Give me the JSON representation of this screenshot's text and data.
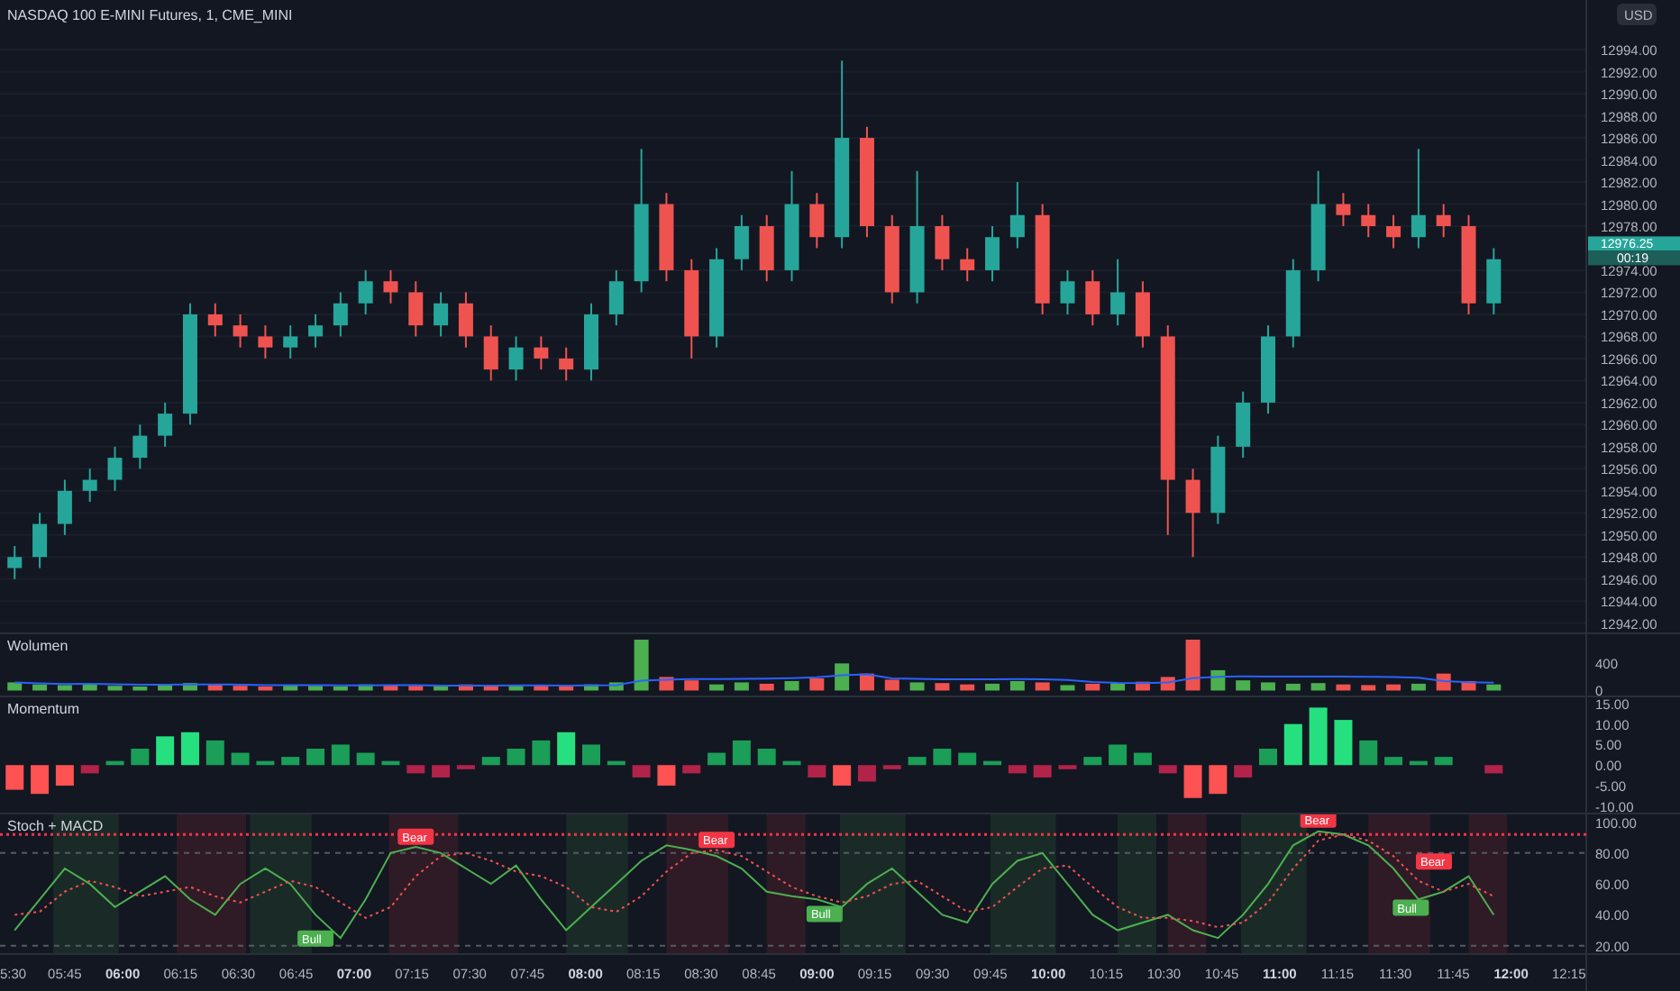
{
  "header": {
    "symbol": "NASDAQ 100 E-MINI Futures, 1, CME_MINI",
    "currency_button": "USD"
  },
  "price_tag": {
    "price": "12976.25",
    "countdown": "00:19"
  },
  "main_pane": {
    "chart_data": {
      "type": "candlestick",
      "grid": true,
      "xlim": [
        328.2,
        763.8
      ],
      "ylim": [
        12941,
        12998.5
      ],
      "x": [
        332,
        338.5,
        345,
        351.5,
        358,
        364.5,
        371,
        377.5,
        384,
        390.5,
        397,
        403.5,
        410,
        416.5,
        423,
        429.5,
        436,
        442.5,
        449,
        455.5,
        462,
        468.5,
        475,
        481.5,
        488,
        494.5,
        501,
        507.5,
        514,
        520.5,
        527,
        533.5,
        540,
        546.5,
        553,
        559.5,
        566,
        572.5,
        579,
        585.5,
        592,
        598.5,
        605,
        611.5,
        618,
        624.5,
        631,
        637.5,
        644,
        650.5,
        657,
        663.5,
        670,
        676.5,
        683,
        689.5,
        696,
        702.5,
        709,
        715.5
      ],
      "yticks": [
        {
          "value": 12994,
          "label": "12994.00"
        },
        {
          "value": 12992,
          "label": "12992.00"
        },
        {
          "value": 12990,
          "label": "12990.00"
        },
        {
          "value": 12988,
          "label": "12988.00"
        },
        {
          "value": 12986,
          "label": "12986.00"
        },
        {
          "value": 12984,
          "label": "12984.00"
        },
        {
          "value": 12982,
          "label": "12982.00"
        },
        {
          "value": 12980,
          "label": "12980.00"
        },
        {
          "value": 12978,
          "label": "12978.00"
        },
        {
          "value": 12974,
          "label": "12974.00"
        },
        {
          "value": 12972,
          "label": "12972.00"
        },
        {
          "value": 12970,
          "label": "12970.00"
        },
        {
          "value": 12968,
          "label": "12968.00"
        },
        {
          "value": 12966,
          "label": "12966.00"
        },
        {
          "value": 12964,
          "label": "12964.00"
        },
        {
          "value": 12962,
          "label": "12962.00"
        },
        {
          "value": 12960,
          "label": "12960.00"
        },
        {
          "value": 12958,
          "label": "12958.00"
        },
        {
          "value": 12956,
          "label": "12956.00"
        },
        {
          "value": 12954,
          "label": "12954.00"
        },
        {
          "value": 12952,
          "label": "12952.00"
        },
        {
          "value": 12950,
          "label": "12950.00"
        },
        {
          "value": 12948,
          "label": "12948.00"
        },
        {
          "value": 12946,
          "label": "12946.00"
        },
        {
          "value": 12944,
          "label": "12944.00"
        },
        {
          "value": 12942,
          "label": "12942.00"
        }
      ],
      "ohlc": [
        [
          12947,
          12949,
          12946,
          12948
        ],
        [
          12948,
          12952,
          12947,
          12951
        ],
        [
          12951,
          12955,
          12950,
          12954
        ],
        [
          12954,
          12956,
          12953,
          12955
        ],
        [
          12955,
          12958,
          12954,
          12957
        ],
        [
          12957,
          12960,
          12956,
          12959
        ],
        [
          12959,
          12962,
          12958,
          12961
        ],
        [
          12961,
          12971,
          12960,
          12970
        ],
        [
          12970,
          12971,
          12968,
          12969
        ],
        [
          12969,
          12970,
          12967,
          12968
        ],
        [
          12968,
          12969,
          12966,
          12967
        ],
        [
          12967,
          12969,
          12966,
          12968
        ],
        [
          12968,
          12970,
          12967,
          12969
        ],
        [
          12969,
          12972,
          12968,
          12971
        ],
        [
          12971,
          12974,
          12970,
          12973
        ],
        [
          12973,
          12974,
          12971,
          12972
        ],
        [
          12972,
          12973,
          12968,
          12969
        ],
        [
          12969,
          12972,
          12968,
          12971
        ],
        [
          12971,
          12972,
          12967,
          12968
        ],
        [
          12968,
          12969,
          12964,
          12965
        ],
        [
          12965,
          12968,
          12964,
          12967
        ],
        [
          12967,
          12968,
          12965,
          12966
        ],
        [
          12966,
          12967,
          12964,
          12965
        ],
        [
          12965,
          12971,
          12964,
          12970
        ],
        [
          12970,
          12974,
          12969,
          12973
        ],
        [
          12973,
          12985,
          12972,
          12980
        ],
        [
          12980,
          12981,
          12973,
          12974
        ],
        [
          12974,
          12975,
          12966,
          12968
        ],
        [
          12968,
          12976,
          12967,
          12975
        ],
        [
          12975,
          12979,
          12974,
          12978
        ],
        [
          12978,
          12979,
          12973,
          12974
        ],
        [
          12974,
          12983,
          12973,
          12980
        ],
        [
          12980,
          12981,
          12976,
          12977
        ],
        [
          12977,
          12993,
          12976,
          12986
        ],
        [
          12986,
          12987,
          12977,
          12978
        ],
        [
          12978,
          12979,
          12971,
          12972
        ],
        [
          12972,
          12983,
          12971,
          12978
        ],
        [
          12978,
          12979,
          12974,
          12975
        ],
        [
          12975,
          12976,
          12973,
          12974
        ],
        [
          12974,
          12978,
          12973,
          12977
        ],
        [
          12977,
          12982,
          12976,
          12979
        ],
        [
          12979,
          12980,
          12970,
          12971
        ],
        [
          12971,
          12974,
          12970,
          12973
        ],
        [
          12973,
          12974,
          12969,
          12970
        ],
        [
          12970,
          12975,
          12969,
          12972
        ],
        [
          12972,
          12973,
          12967,
          12968
        ],
        [
          12968,
          12969,
          12950,
          12955
        ],
        [
          12955,
          12956,
          12948,
          12952
        ],
        [
          12952,
          12959,
          12951,
          12958
        ],
        [
          12958,
          12963,
          12957,
          12962
        ],
        [
          12962,
          12969,
          12961,
          12968
        ],
        [
          12968,
          12975,
          12967,
          12974
        ],
        [
          12974,
          12983,
          12973,
          12980
        ],
        [
          12980,
          12981,
          12978,
          12979
        ],
        [
          12979,
          12980,
          12977,
          12978
        ],
        [
          12978,
          12979,
          12976,
          12977
        ],
        [
          12977,
          12985,
          12976,
          12979
        ],
        [
          12979,
          12980,
          12977,
          12978
        ],
        [
          12978,
          12979,
          12970,
          12971
        ],
        [
          12971,
          12976,
          12970,
          12975
        ]
      ]
    }
  },
  "volume_pane": {
    "title": "Wolumen",
    "chart_data": {
      "type": "bar",
      "xlim": [
        328.2,
        763.8
      ],
      "ylim": [
        -100,
        830
      ],
      "yticks": [
        0,
        400
      ],
      "x": [
        332,
        338.5,
        345,
        351.5,
        358,
        364.5,
        371,
        377.5,
        384,
        390.5,
        397,
        403.5,
        410,
        416.5,
        423,
        429.5,
        436,
        442.5,
        449,
        455.5,
        462,
        468.5,
        475,
        481.5,
        488,
        494.5,
        501,
        507.5,
        514,
        520.5,
        527,
        533.5,
        540,
        546.5,
        553,
        559.5,
        566,
        572.5,
        579,
        585.5,
        592,
        598.5,
        605,
        611.5,
        618,
        624.5,
        631,
        637.5,
        644,
        650.5,
        657,
        663.5,
        670,
        676.5,
        683,
        689.5,
        696,
        702.5,
        709,
        715.5
      ],
      "series": [
        {
          "color": "#4caf50",
          "values": [
            120,
            90,
            80,
            100,
            70,
            60,
            80,
            110,
            null,
            null,
            null,
            80,
            70,
            60,
            90,
            null,
            null,
            60,
            null,
            null,
            70,
            null,
            null,
            90,
            120,
            750,
            null,
            null,
            90,
            120,
            null,
            140,
            null,
            400,
            null,
            null,
            120,
            null,
            null,
            100,
            140,
            null,
            80,
            null,
            110,
            null,
            null,
            null,
            300,
            150,
            120,
            100,
            110,
            null,
            null,
            null,
            100,
            null,
            null,
            90
          ]
        },
        {
          "color": "#ef5350",
          "values": [
            null,
            null,
            null,
            null,
            null,
            null,
            null,
            null,
            90,
            70,
            60,
            null,
            null,
            null,
            null,
            80,
            70,
            null,
            90,
            80,
            null,
            80,
            60,
            null,
            null,
            null,
            200,
            150,
            null,
            null,
            100,
            null,
            180,
            null,
            250,
            160,
            null,
            110,
            90,
            null,
            null,
            120,
            null,
            100,
            null,
            130,
            200,
            750,
            null,
            null,
            null,
            null,
            null,
            90,
            80,
            90,
            null,
            250,
            140,
            null
          ]
        },
        {
          "color": "#2962ff",
          "type": "line",
          "values": [
            120,
            105,
            97,
            98,
            92,
            87,
            86,
            89,
            89,
            87,
            81,
            80,
            79,
            75,
            77,
            79,
            78,
            73,
            73,
            74,
            75,
            75,
            74,
            77,
            80,
            147,
            160,
            169,
            169,
            173,
            176,
            182,
            194,
            225,
            238,
            179,
            171,
            167,
            167,
            165,
            169,
            167,
            157,
            127,
            113,
            110,
            118,
            182,
            203,
            208,
            206,
            204,
            207,
            206,
            203,
            199,
            189,
            139,
            123,
            117
          ]
        }
      ]
    }
  },
  "momentum_pane": {
    "title": "Momentum",
    "chart_data": {
      "type": "bar",
      "xlim": [
        328.2,
        763.8
      ],
      "ylim": [
        -12,
        16.5
      ],
      "yticks": [
        {
          "value": 15,
          "label": "15.00"
        },
        {
          "value": 10,
          "label": "10.00"
        },
        {
          "value": 5,
          "label": "5.00"
        },
        {
          "value": 0,
          "label": "0.00"
        },
        {
          "value": -5,
          "label": "-5.00"
        },
        {
          "value": -10,
          "label": "-10.00"
        }
      ],
      "x": [
        332,
        338.5,
        345,
        351.5,
        358,
        364.5,
        371,
        377.5,
        384,
        390.5,
        397,
        403.5,
        410,
        416.5,
        423,
        429.5,
        436,
        442.5,
        449,
        455.5,
        462,
        468.5,
        475,
        481.5,
        488,
        494.5,
        501,
        507.5,
        514,
        520.5,
        527,
        533.5,
        540,
        546.5,
        553,
        559.5,
        566,
        572.5,
        579,
        585.5,
        592,
        598.5,
        605,
        611.5,
        618,
        624.5,
        631,
        637.5,
        644,
        650.5,
        657,
        663.5,
        670,
        676.5,
        683,
        689.5,
        696,
        702.5,
        709,
        715.5
      ],
      "values": [
        -6,
        -7,
        -5,
        -2,
        1,
        4,
        7,
        8,
        6,
        3,
        1,
        2,
        4,
        5,
        3,
        1,
        -2,
        -3,
        -1,
        2,
        4,
        6,
        8,
        5,
        1,
        -3,
        -5,
        -2,
        3,
        6,
        4,
        1,
        -3,
        -5,
        -4,
        -1,
        2,
        4,
        3,
        1,
        -2,
        -3,
        -1,
        2,
        5,
        3,
        -2,
        -8,
        -7,
        -3,
        4,
        10,
        14,
        11,
        6,
        2,
        1,
        2,
        0,
        -2
      ]
    }
  },
  "stoch_pane": {
    "title": "Stoch + MACD",
    "chart_data": {
      "type": "line",
      "xlim": [
        328.2,
        763.8
      ],
      "ylim": [
        14,
        105
      ],
      "x": [
        332,
        338.5,
        345,
        351.5,
        358,
        364.5,
        371,
        377.5,
        384,
        390.5,
        397,
        403.5,
        410,
        416.5,
        423,
        429.5,
        436,
        442.5,
        449,
        455.5,
        462,
        468.5,
        475,
        481.5,
        488,
        494.5,
        501,
        507.5,
        514,
        520.5,
        527,
        533.5,
        540,
        546.5,
        553,
        559.5,
        566,
        572.5,
        579,
        585.5,
        592,
        598.5,
        605,
        611.5,
        618,
        624.5,
        631,
        637.5,
        644,
        650.5,
        657,
        663.5,
        670,
        676.5,
        683,
        689.5,
        696,
        702.5,
        709,
        715.5
      ],
      "xticks": [
        {
          "value": 330,
          "label": "5:30"
        },
        {
          "value": 345,
          "label": "05:45"
        },
        {
          "value": 360,
          "label": "06:00"
        },
        {
          "value": 375,
          "label": "06:15"
        },
        {
          "value": 390,
          "label": "06:30"
        },
        {
          "value": 405,
          "label": "06:45"
        },
        {
          "value": 420,
          "label": "07:00"
        },
        {
          "value": 435,
          "label": "07:15"
        },
        {
          "value": 450,
          "label": "07:30"
        },
        {
          "value": 465,
          "label": "07:45"
        },
        {
          "value": 480,
          "label": "08:00"
        },
        {
          "value": 495,
          "label": "08:15"
        },
        {
          "value": 510,
          "label": "08:30"
        },
        {
          "value": 525,
          "label": "08:45"
        },
        {
          "value": 540,
          "label": "09:00"
        },
        {
          "value": 555,
          "label": "09:15"
        },
        {
          "value": 570,
          "label": "09:30"
        },
        {
          "value": 585,
          "label": "09:45"
        },
        {
          "value": 600,
          "label": "10:00"
        },
        {
          "value": 615,
          "label": "10:15"
        },
        {
          "value": 630,
          "label": "10:30"
        },
        {
          "value": 645,
          "label": "10:45"
        },
        {
          "value": 660,
          "label": "11:00"
        },
        {
          "value": 675,
          "label": "11:15"
        },
        {
          "value": 690,
          "label": "11:30"
        },
        {
          "value": 705,
          "label": "11:45"
        },
        {
          "value": 720,
          "label": "12:00"
        },
        {
          "value": 735,
          "label": "12:15"
        }
      ],
      "yticks": [
        {
          "value": 100,
          "label": "100.00"
        },
        {
          "value": 80,
          "label": "80.00"
        },
        {
          "value": 60,
          "label": "60.00"
        },
        {
          "value": 40,
          "label": "40.00"
        },
        {
          "value": 20,
          "label": "20.00"
        }
      ],
      "bands": [
        {
          "axis": "x",
          "from": 342,
          "to": 359,
          "color": "#4caf50"
        },
        {
          "axis": "x",
          "from": 374,
          "to": 392,
          "color": "#f23645"
        },
        {
          "axis": "x",
          "from": 393,
          "to": 409,
          "color": "#4caf50"
        },
        {
          "axis": "x",
          "from": 429,
          "to": 447,
          "color": "#f23645"
        },
        {
          "axis": "x",
          "from": 475,
          "to": 491,
          "color": "#4caf50"
        },
        {
          "axis": "x",
          "from": 501,
          "to": 517,
          "color": "#f23645"
        },
        {
          "axis": "x",
          "from": 527,
          "to": 537,
          "color": "#f23645"
        },
        {
          "axis": "x",
          "from": 546,
          "to": 563,
          "color": "#4caf50"
        },
        {
          "axis": "x",
          "from": 585,
          "to": 602,
          "color": "#4caf50"
        },
        {
          "axis": "x",
          "from": 618,
          "to": 628,
          "color": "#4caf50"
        },
        {
          "axis": "x",
          "from": 631,
          "to": 641,
          "color": "#f23645"
        },
        {
          "axis": "x",
          "from": 650,
          "to": 667,
          "color": "#4caf50"
        },
        {
          "axis": "x",
          "from": 683,
          "to": 699,
          "color": "#f23645"
        },
        {
          "axis": "x",
          "from": 709,
          "to": 719,
          "color": "#f23645"
        }
      ],
      "ref_lines": [
        {
          "axis": "y",
          "value": 92,
          "color": "#f23645"
        },
        {
          "axis": "y",
          "value": 80,
          "color": "#555a66"
        },
        {
          "axis": "y",
          "value": 20,
          "color": "#555a66"
        }
      ],
      "series": [
        {
          "color": "#4caf50",
          "line_style": "solid",
          "values": [
            30,
            50,
            70,
            60,
            45,
            55,
            65,
            50,
            40,
            60,
            70,
            60,
            40,
            25,
            50,
            80,
            84,
            80,
            70,
            60,
            72,
            50,
            30,
            45,
            60,
            75,
            85,
            82,
            78,
            70,
            55,
            52,
            50,
            45,
            60,
            70,
            55,
            40,
            35,
            60,
            75,
            80,
            60,
            40,
            30,
            35,
            40,
            30,
            25,
            40,
            60,
            85,
            94,
            92,
            85,
            70,
            50,
            55,
            65,
            40
          ]
        },
        {
          "color": "#ef5350",
          "line_style": "dotted",
          "values": [
            40,
            42,
            55,
            62,
            58,
            52,
            55,
            58,
            52,
            48,
            55,
            62,
            58,
            48,
            38,
            45,
            65,
            78,
            80,
            75,
            68,
            65,
            58,
            45,
            42,
            52,
            68,
            80,
            82,
            78,
            68,
            58,
            52,
            48,
            52,
            60,
            62,
            52,
            42,
            45,
            58,
            70,
            72,
            58,
            45,
            38,
            38,
            36,
            32,
            35,
            48,
            70,
            88,
            92,
            88,
            78,
            62,
            55,
            60,
            52
          ]
        }
      ],
      "annotations": [
        {
          "x": 410,
          "y": 24,
          "text": "Bull"
        },
        {
          "x": 436,
          "y": 90,
          "text": "Bear"
        },
        {
          "x": 514,
          "y": 88,
          "text": "Bear"
        },
        {
          "x": 542,
          "y": 40,
          "text": "Bull"
        },
        {
          "x": 670,
          "y": 101,
          "text": "Bear"
        },
        {
          "x": 694,
          "y": 44,
          "text": "Bull"
        },
        {
          "x": 700,
          "y": 74,
          "text": "Bear"
        }
      ]
    }
  }
}
